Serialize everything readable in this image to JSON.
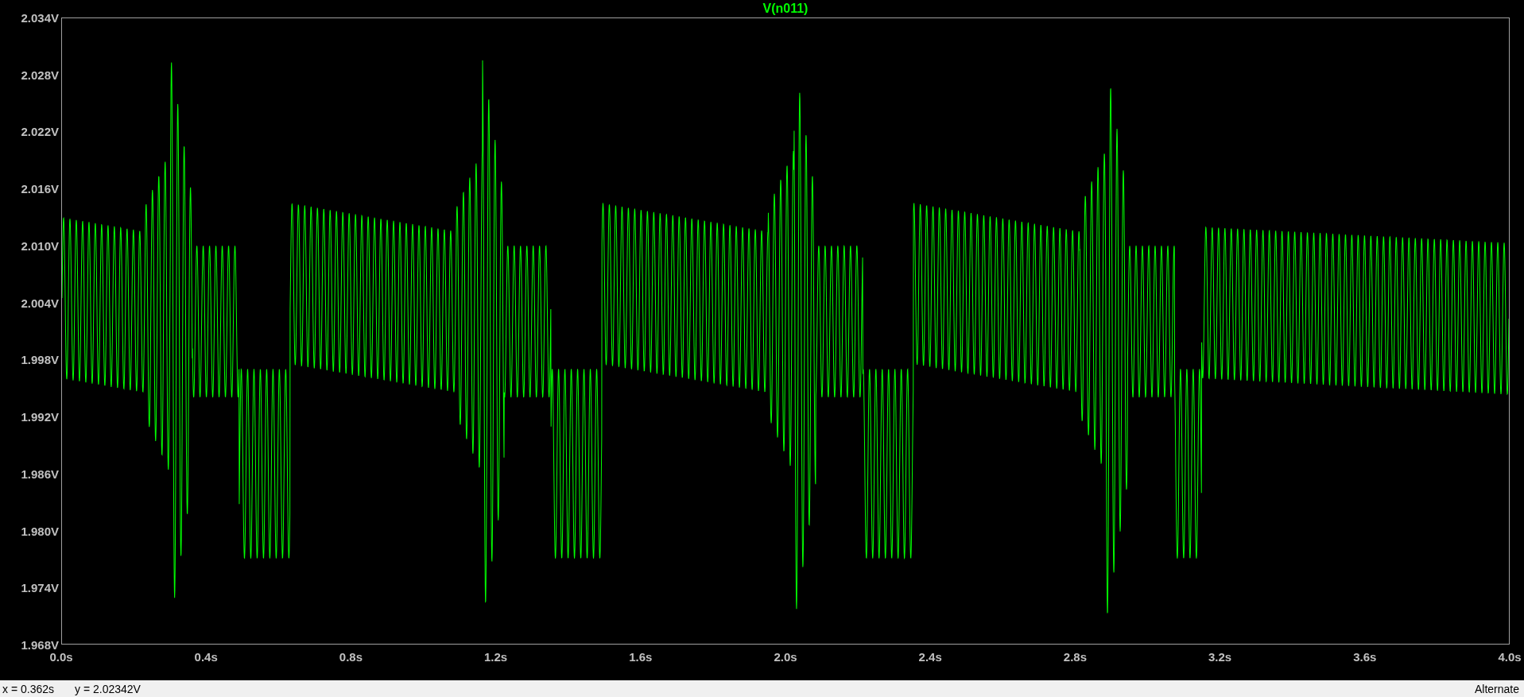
{
  "trace": {
    "label": "V(n011)"
  },
  "y_axis": {
    "ticks": [
      "2.034V",
      "2.028V",
      "2.022V",
      "2.016V",
      "2.010V",
      "2.004V",
      "1.998V",
      "1.992V",
      "1.986V",
      "1.980V",
      "1.974V",
      "1.968V"
    ]
  },
  "x_axis": {
    "ticks": [
      "0.0s",
      "0.4s",
      "0.8s",
      "1.2s",
      "1.6s",
      "2.0s",
      "2.4s",
      "2.8s",
      "3.2s",
      "3.6s",
      "4.0s"
    ]
  },
  "status_bar": {
    "cursor_x": "x = 0.362s",
    "cursor_y": "y = 2.02342V",
    "mode": "Alternate"
  }
}
